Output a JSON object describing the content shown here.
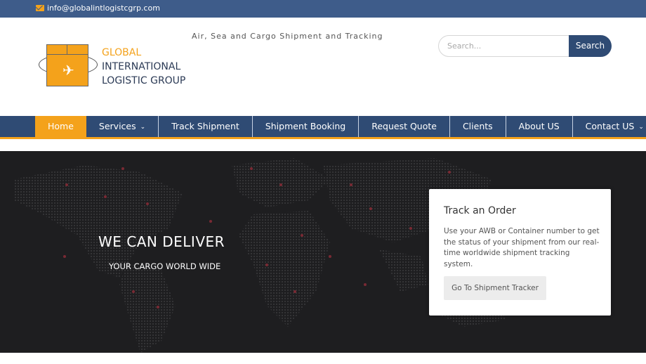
{
  "topbar": {
    "email": "info@globalintlogistcgrp.com",
    "icon": "envelope-icon"
  },
  "header": {
    "logo": {
      "line1": "GLOBAL",
      "line2": "INTERNATIONAL",
      "line3": "LOGISTIC GROUP",
      "icon": "airplane-icon"
    },
    "tagline": "Air, Sea and Cargo Shipment and Tracking",
    "search": {
      "placeholder": "Search...",
      "button_label": "Search"
    }
  },
  "nav": {
    "items": [
      {
        "label": "Home",
        "active": true
      },
      {
        "label": "Services",
        "has_dropdown": true
      },
      {
        "label": "Track Shipment"
      },
      {
        "label": "Shipment Booking"
      },
      {
        "label": "Request Quote"
      },
      {
        "label": "Clients"
      },
      {
        "label": "About US"
      },
      {
        "label": "Contact US",
        "has_dropdown": true
      }
    ]
  },
  "hero": {
    "title": "WE CAN DELIVER",
    "subtitle": "YOUR CARGO WORLD WIDE"
  },
  "track_card": {
    "title": "Track an Order",
    "description": "Use your AWB or Container number to get the status of your shipment from our real-time worldwide shipment tracking system.",
    "button_label": "Go To Shipment Tracker"
  },
  "colors": {
    "accent": "#f4a21b",
    "nav_bg": "#2f4b74",
    "topbar_bg": "#3e5c8a",
    "hero_bg": "#1e1e20"
  }
}
